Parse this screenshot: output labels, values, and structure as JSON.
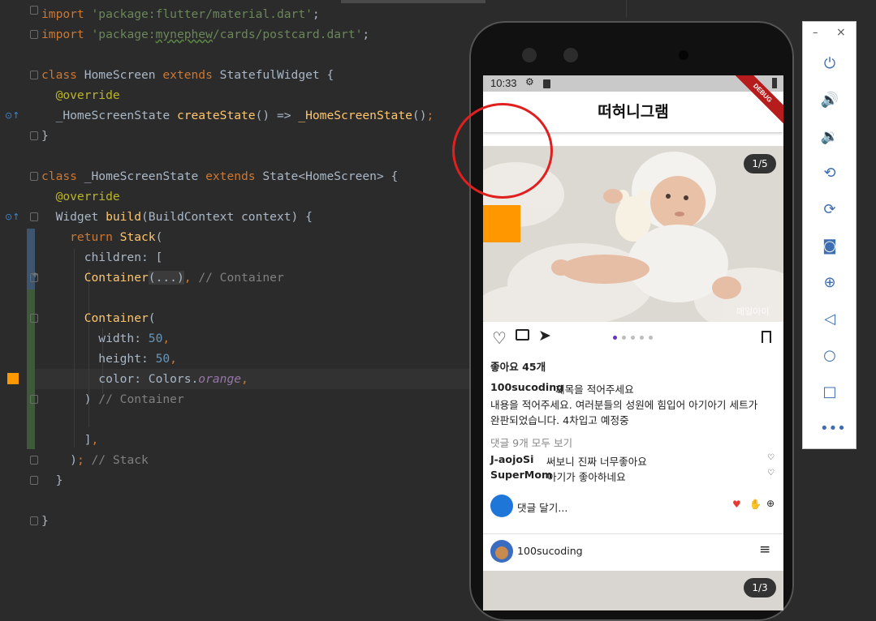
{
  "editor": {
    "lines": [
      {
        "n": 0,
        "parts": [
          [
            "kw",
            "import "
          ],
          [
            "str",
            "'package:flutter/material.dart'"
          ],
          [
            "prm",
            ";"
          ]
        ]
      },
      {
        "n": 1,
        "parts": [
          [
            "kw",
            "import "
          ],
          [
            "str",
            "'package:"
          ],
          [
            "str und",
            "mynephew"
          ],
          [
            "str",
            "/cards/postcard.dart'"
          ],
          [
            "prm",
            ";"
          ]
        ]
      },
      {
        "n": 2,
        "parts": []
      },
      {
        "n": 3,
        "parts": [
          [
            "kw",
            "class "
          ],
          [
            "prm",
            "HomeScreen "
          ],
          [
            "kw",
            "extends "
          ],
          [
            "prm",
            "StatefulWidget {"
          ]
        ]
      },
      {
        "n": 4,
        "parts": [
          [
            "ann",
            "  @override"
          ]
        ]
      },
      {
        "n": 5,
        "parts": [
          [
            "prm",
            "  _HomeScreenState "
          ],
          [
            "fn",
            "createState"
          ],
          [
            "prm",
            "() => "
          ],
          [
            "fn",
            "_HomeScreenState"
          ],
          [
            "prm",
            "()"
          ],
          [
            "kw",
            ";"
          ]
        ]
      },
      {
        "n": 6,
        "parts": [
          [
            "prm",
            "}"
          ]
        ]
      },
      {
        "n": 7,
        "parts": []
      },
      {
        "n": 8,
        "parts": [
          [
            "kw",
            "class "
          ],
          [
            "prm",
            "_HomeScreenState "
          ],
          [
            "kw",
            "extends "
          ],
          [
            "prm",
            "State<HomeScreen> {"
          ]
        ]
      },
      {
        "n": 9,
        "parts": [
          [
            "ann",
            "  @override"
          ]
        ]
      },
      {
        "n": 10,
        "parts": [
          [
            "prm",
            "  Widget "
          ],
          [
            "fn",
            "build"
          ],
          [
            "prm",
            "(BuildContext context) {"
          ]
        ]
      },
      {
        "n": 11,
        "parts": [
          [
            "kw",
            "    return "
          ],
          [
            "fn",
            "Stack"
          ],
          [
            "prm",
            "("
          ]
        ]
      },
      {
        "n": 12,
        "parts": [
          [
            "prm",
            "      children: ["
          ]
        ]
      },
      {
        "n": 13,
        "parts": [
          [
            "prm",
            "      "
          ],
          [
            "fn",
            "Container"
          ],
          [
            "fold-text",
            "(...)"
          ],
          [
            "kw",
            ", "
          ],
          [
            "cmt",
            "// Container"
          ]
        ]
      },
      {
        "n": 14,
        "parts": []
      },
      {
        "n": 15,
        "parts": [
          [
            "prm",
            "      "
          ],
          [
            "fn",
            "Container"
          ],
          [
            "prm",
            "("
          ]
        ]
      },
      {
        "n": 16,
        "parts": [
          [
            "prm",
            "        width: "
          ],
          [
            "num",
            "50"
          ],
          [
            "kw",
            ","
          ]
        ]
      },
      {
        "n": 17,
        "parts": [
          [
            "prm",
            "        height: "
          ],
          [
            "num",
            "50"
          ],
          [
            "kw",
            ","
          ]
        ]
      },
      {
        "n": 18,
        "parts": [
          [
            "prm",
            "        color: Colors."
          ],
          [
            "ital",
            "orange"
          ],
          [
            "kw",
            ","
          ]
        ]
      },
      {
        "n": 19,
        "parts": [
          [
            "prm",
            "      ) "
          ],
          [
            "cmt",
            "// Container"
          ]
        ]
      },
      {
        "n": 20,
        "parts": []
      },
      {
        "n": 21,
        "parts": [
          [
            "prm",
            "      ]"
          ],
          [
            "kw",
            ","
          ]
        ]
      },
      {
        "n": 22,
        "parts": [
          [
            "prm",
            "    )"
          ],
          [
            "kw",
            "; "
          ],
          [
            "cmt",
            "// Stack"
          ]
        ]
      },
      {
        "n": 23,
        "parts": [
          [
            "prm",
            "  }"
          ]
        ]
      },
      {
        "n": 24,
        "parts": []
      },
      {
        "n": 25,
        "parts": [
          [
            "prm",
            "}"
          ]
        ]
      }
    ],
    "colors": {
      "background": "#2b2b2b",
      "keyword": "#cc7832",
      "string": "#6a8759",
      "annotation": "#bbb529",
      "function": "#ffc66d",
      "number": "#6897bb",
      "comment": "#808080",
      "swatch": "#ff9800"
    }
  },
  "phone": {
    "status": {
      "time": "10:33"
    },
    "appbar": {
      "title": "떠혀니그램",
      "debug_banner": "DEBUG"
    },
    "post": {
      "page_indicator": "1/5",
      "watermark": "매일아이",
      "likes": "좋아요 45개",
      "author": "100sucoding",
      "caption_title": "제목을 적어주세요",
      "caption_line1": "내용을 적어주세요. 여러분들의 성원에 힘입어 아기아기 세트가",
      "caption_line2": "완판되었습니다. 4차입고 예정중",
      "view_comments": "댓글 9개 모두 보기",
      "comments": [
        {
          "user": "J-aojoSi",
          "text": "써보니 진짜 너무좋아요"
        },
        {
          "user": "SuperMom",
          "text": "아기가 좋아하네요"
        }
      ],
      "comment_placeholder": "댓글 달기...",
      "reactions": [
        "heart-icon",
        "clap-icon",
        "add-icon"
      ]
    },
    "next_post": {
      "author": "100sucoding",
      "page_indicator": "1/3"
    },
    "orange_box_color": "#ff9800"
  },
  "toolbar": {
    "minimize": "–",
    "close": "×",
    "items": [
      "power-icon",
      "volume-up-icon",
      "volume-down-icon",
      "rotate-left-icon",
      "rotate-right-icon",
      "camera-icon",
      "zoom-icon",
      "back-icon",
      "home-icon",
      "overview-icon",
      "more-icon"
    ]
  }
}
